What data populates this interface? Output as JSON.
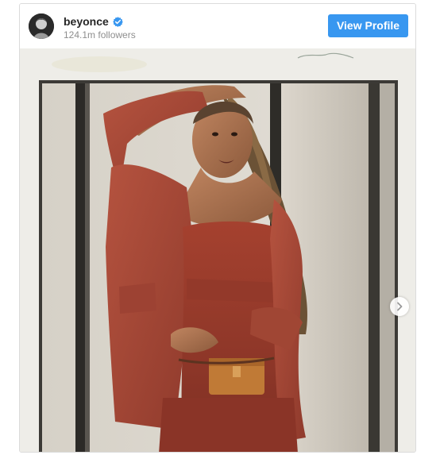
{
  "header": {
    "username": "beyonce",
    "followers": "124.1m followers",
    "view_profile_label": "View Profile"
  },
  "icons": {
    "verified": "verified-badge-icon",
    "next": "chevron-right-icon"
  },
  "colors": {
    "button_blue": "#3897f0",
    "verified_blue": "#3897f0",
    "username_text": "#262626",
    "followers_text": "#8e8e8e"
  }
}
